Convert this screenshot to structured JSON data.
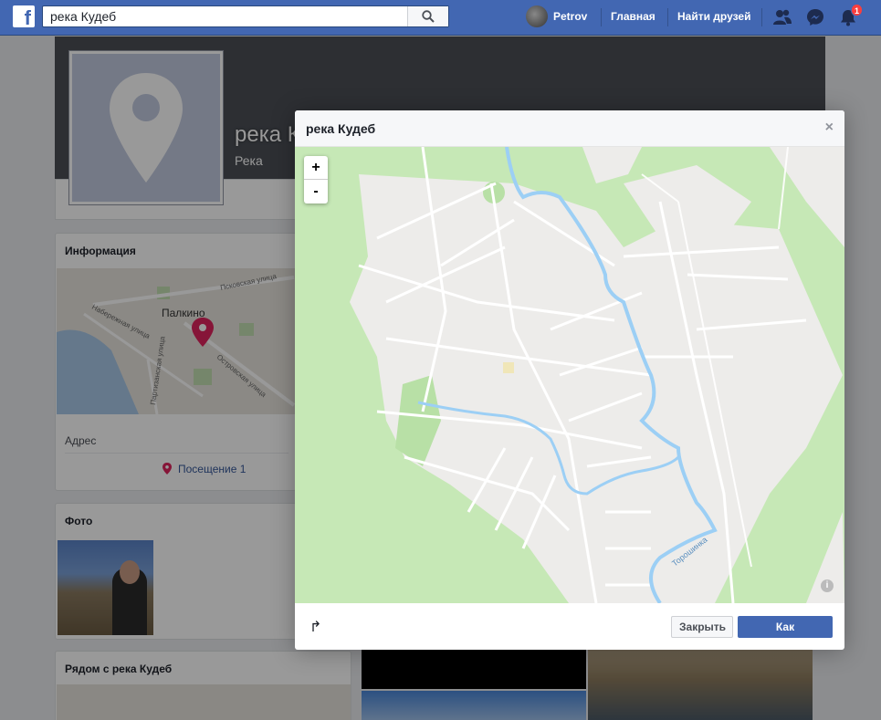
{
  "topbar": {
    "search_value": "река Кудеб",
    "user_name": "Petrov",
    "nav_home": "Главная",
    "nav_find_friends": "Найти друзей",
    "notifications_count": "1",
    "colors": {
      "bar": "#4267b2"
    }
  },
  "page": {
    "name": "река Кудеб",
    "category": "Река"
  },
  "info_card": {
    "title": "Информация",
    "map_labels": {
      "town": "Палкино",
      "street1": "Псковская улица",
      "street2": "Набережная улица",
      "street3": "Островская улица",
      "street4": "Партизанская улица"
    },
    "address_label": "Адрес",
    "visits_label": "Посещение 1"
  },
  "photo_card": {
    "title": "Фото"
  },
  "nearby_card": {
    "title": "Рядом с река Кудеб"
  },
  "modal": {
    "title": "река Кудеб",
    "close_symbol": "×",
    "zoom_in": "+",
    "zoom_out": "-",
    "river_label": "Торошинка",
    "info_symbol": "i",
    "share_symbol": "↱",
    "btn_close": "Закрыть",
    "btn_directions": "Как добраться"
  }
}
